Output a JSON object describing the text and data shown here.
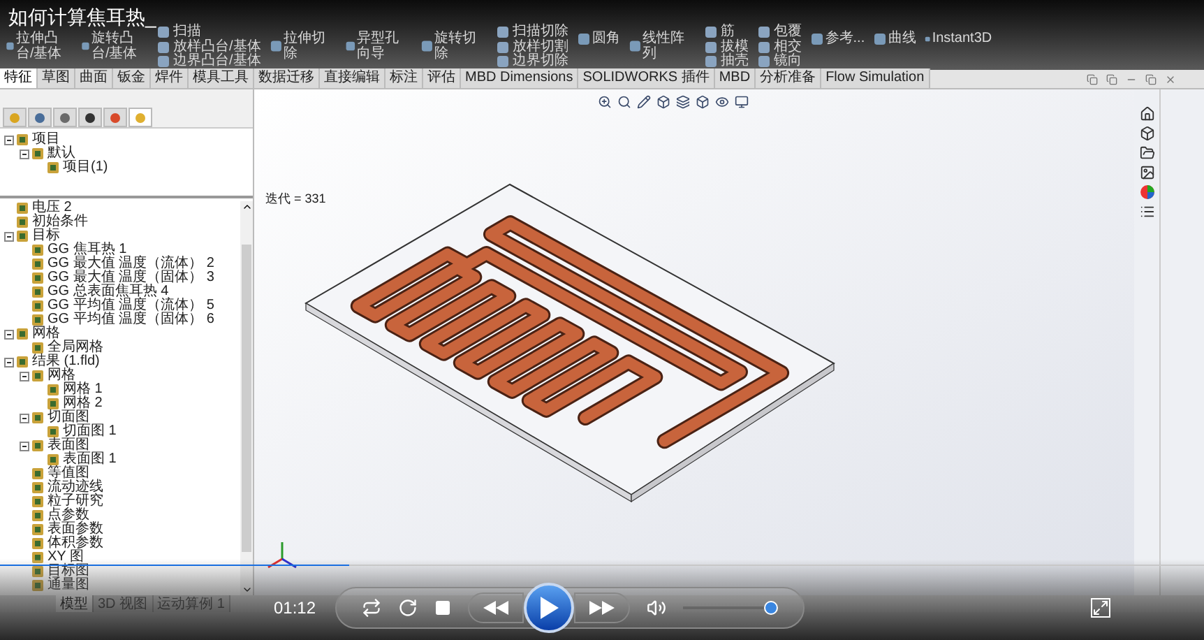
{
  "video": {
    "title": "如何计算焦耳热_"
  },
  "ribbon": [
    {
      "kind": "big",
      "label": "拉伸凸台/基体"
    },
    {
      "kind": "big",
      "label": "旋转凸台/基体"
    },
    {
      "kind": "stack",
      "items": [
        "扫描",
        "放样凸台/基体",
        "边界凸台/基体"
      ]
    },
    {
      "kind": "big",
      "label": "拉伸切除"
    },
    {
      "kind": "big",
      "label": "异型孔向导"
    },
    {
      "kind": "big",
      "label": "旋转切除"
    },
    {
      "kind": "stack",
      "items": [
        "扫描切除",
        "放样切割",
        "边界切除"
      ]
    },
    {
      "kind": "big",
      "label": "圆角"
    },
    {
      "kind": "big",
      "label": "线性阵列"
    },
    {
      "kind": "stack",
      "items": [
        "筋",
        "拔模",
        "抽壳"
      ]
    },
    {
      "kind": "stack",
      "items": [
        "包覆",
        "相交",
        "镜向"
      ]
    },
    {
      "kind": "big",
      "label": "参考..."
    },
    {
      "kind": "big",
      "label": "曲线"
    },
    {
      "kind": "big",
      "label": "Instant3D"
    }
  ],
  "tabs": [
    {
      "label": "特征",
      "selected": true
    },
    {
      "label": "草图",
      "selected": false
    },
    {
      "label": "曲面",
      "selected": false
    },
    {
      "label": "钣金",
      "selected": false
    },
    {
      "label": "焊件",
      "selected": false
    },
    {
      "label": "模具工具",
      "selected": false
    },
    {
      "label": "数据迁移",
      "selected": false
    },
    {
      "label": "直接编辑",
      "selected": false
    },
    {
      "label": "标注",
      "selected": false
    },
    {
      "label": "评估",
      "selected": false
    },
    {
      "label": "MBD Dimensions",
      "selected": false
    },
    {
      "label": "SOLIDWORKS 插件",
      "selected": false
    },
    {
      "label": "MBD",
      "selected": false
    },
    {
      "label": "分析准备",
      "selected": false
    },
    {
      "label": "Flow Simulation",
      "selected": false
    }
  ],
  "panel_tabs": [
    {
      "selected": false
    },
    {
      "selected": false
    },
    {
      "selected": false
    },
    {
      "selected": false
    },
    {
      "selected": false
    },
    {
      "selected": true
    }
  ],
  "tree_top": [
    {
      "label": "项目",
      "children": [
        {
          "label": "默认",
          "children": [
            {
              "label": "项目(1)"
            }
          ]
        }
      ]
    }
  ],
  "tree": [
    {
      "label": "电压 2"
    },
    {
      "label": "初始条件"
    },
    {
      "label": "目标",
      "children": [
        {
          "label": "GG 焦耳热 1"
        },
        {
          "label": "GG 最大值 温度（流体） 2"
        },
        {
          "label": "GG 最大值 温度（固体） 3"
        },
        {
          "label": "GG 总表面焦耳热 4"
        },
        {
          "label": "GG 平均值 温度（流体） 5"
        },
        {
          "label": "GG 平均值 温度（固体） 6"
        }
      ]
    },
    {
      "label": "网格",
      "children": [
        {
          "label": "全局网格"
        }
      ]
    },
    {
      "label": "结果 (1.fld)",
      "children": [
        {
          "label": "网格",
          "children": [
            {
              "label": "网格 1"
            },
            {
              "label": "网格 2"
            }
          ]
        },
        {
          "label": "切面图",
          "children": [
            {
              "label": "切面图 1"
            }
          ]
        },
        {
          "label": "表面图",
          "children": [
            {
              "label": "表面图 1"
            }
          ]
        },
        {
          "label": "等值图"
        },
        {
          "label": "流动迹线"
        },
        {
          "label": "粒子研究"
        },
        {
          "label": "点参数"
        },
        {
          "label": "表面参数"
        },
        {
          "label": "体积参数"
        },
        {
          "label": "XY 图"
        },
        {
          "label": "目标图"
        },
        {
          "label": "通量图"
        }
      ]
    }
  ],
  "graphics": {
    "label": "迭代 = 331"
  },
  "bottom_tabs": [
    {
      "label": "模型",
      "selected": true
    },
    {
      "label": "3D 视图",
      "selected": false
    },
    {
      "label": "运动算例 1",
      "selected": false
    }
  ],
  "player": {
    "time": "01:12",
    "progress": {
      "level": 0.29
    },
    "volume": {
      "level": 0.92
    }
  }
}
